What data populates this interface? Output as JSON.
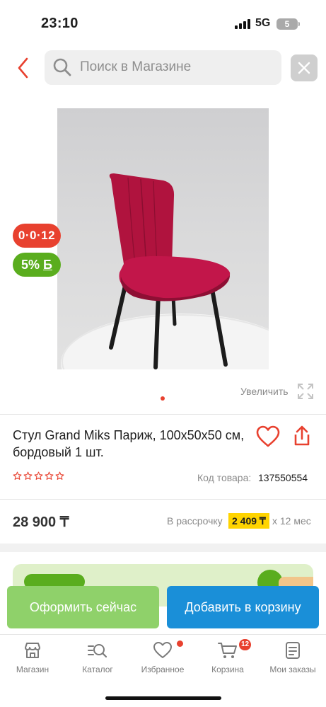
{
  "status_bar": {
    "time": "23:10",
    "network": "5G",
    "battery": "5"
  },
  "search": {
    "placeholder": "Поиск в Магазине"
  },
  "badges": {
    "timer": "0·0·12",
    "bonus_percent": "5%",
    "bonus_currency": "Б"
  },
  "gallery": {
    "zoom_label": "Увеличить",
    "total_images": 1,
    "active_index": 0
  },
  "product": {
    "title": "Стул Grand Miks Париж, 100х50х50 см, бордовый 1 шт.",
    "rating": 0,
    "code_label": "Код товара:",
    "code_value": "137550554"
  },
  "price": {
    "value": "28 900 ₸",
    "installment_label": "В рассрочку",
    "installment_amount": "2 409 ₸",
    "installment_term": "х 12 мес"
  },
  "actions": {
    "buy_now": "Оформить сейчас",
    "add_to_cart": "Добавить в корзину"
  },
  "tabbar": {
    "items": [
      {
        "label": "Магазин",
        "icon": "shop-icon"
      },
      {
        "label": "Каталог",
        "icon": "catalog-search-icon"
      },
      {
        "label": "Избранное",
        "icon": "heart-icon"
      },
      {
        "label": "Корзина",
        "icon": "cart-icon"
      },
      {
        "label": "Мои заказы",
        "icon": "orders-icon"
      }
    ],
    "cart_count": "12"
  },
  "colors": {
    "accent_red": "#e8412f",
    "bonus_green": "#5aad1e",
    "buy_now_green": "#8fd16a",
    "cart_blue": "#1a8fd8",
    "installment_yellow": "#ffd400"
  }
}
